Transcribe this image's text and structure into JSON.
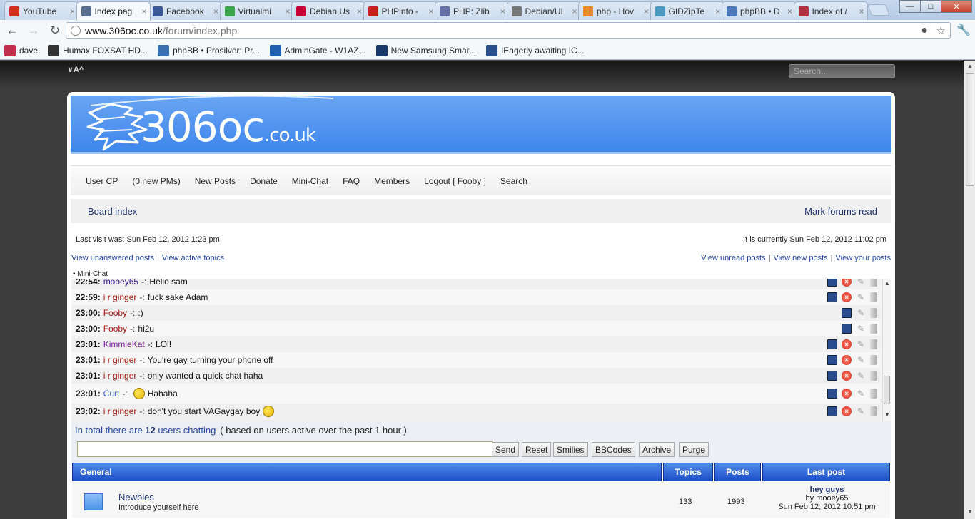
{
  "browser": {
    "tabs": [
      {
        "title": "YouTube",
        "icon": "youtube-icon",
        "color": "#d52f20"
      },
      {
        "title": "Index pag",
        "icon": "shield-icon",
        "color": "#5a6f8f",
        "active": true
      },
      {
        "title": "Facebook",
        "icon": "facebook-icon",
        "color": "#3b5998"
      },
      {
        "title": "Virtualmi",
        "icon": "check-icon",
        "color": "#3aa44a"
      },
      {
        "title": "Debian Us",
        "icon": "debian-icon",
        "color": "#c70036"
      },
      {
        "title": "PHPinfo -",
        "icon": "circle-icon",
        "color": "#c9201e"
      },
      {
        "title": "PHP: Zlib",
        "icon": "php-icon",
        "color": "#6670a8"
      },
      {
        "title": "Debian/UI",
        "icon": "gear-icon",
        "color": "#777777"
      },
      {
        "title": "php - Hov",
        "icon": "stack-icon",
        "color": "#e48a2a"
      },
      {
        "title": "GIDZipTe",
        "icon": "g-icon",
        "color": "#4a9ac0"
      },
      {
        "title": "phpBB • D",
        "icon": "people-icon",
        "color": "#4a78b8"
      },
      {
        "title": "Index of /",
        "icon": "apache-icon",
        "color": "#b03040"
      }
    ],
    "address": {
      "host": "www.306oc.co.uk",
      "path": "/forum/index.php"
    },
    "bookmarks": [
      {
        "label": "dave",
        "icon": "bookmark-icon",
        "color": "#c0304a"
      },
      {
        "label": "Humax FOXSAT HD...",
        "icon": "avforums-icon",
        "color": "#333333"
      },
      {
        "label": "phpBB • Prosilver: Pr...",
        "icon": "phpbb-icon",
        "color": "#3a6fb0"
      },
      {
        "label": "AdminGate - W1AZ...",
        "icon": "admingate-icon",
        "color": "#2060b0"
      },
      {
        "label": "New Samsung Smar...",
        "icon": "c-icon",
        "color": "#1a3a6a"
      },
      {
        "label": "IEagerly awaiting IC...",
        "icon": "android-icon",
        "color": "#2a4f8a"
      }
    ]
  },
  "site": {
    "top_links": "∨A^",
    "search_placeholder": "Search...",
    "logo": {
      "main": "306oc",
      "tld": ".co.uk"
    },
    "nav": [
      "User CP",
      "(0 new PMs)",
      "New Posts",
      "Donate",
      "Mini-Chat",
      "FAQ",
      "Members",
      "Logout [ Fooby ]",
      "Search"
    ],
    "breadcrumb": "Board index",
    "mark_read": "Mark forums read",
    "last_visit": "Last visit was: Sun Feb 12, 2012 1:23 pm",
    "current_time": "It is currently Sun Feb 12, 2012 11:02 pm",
    "quick_left": [
      "View unanswered posts",
      "View active topics"
    ],
    "quick_right": [
      "View unread posts",
      "View new posts",
      "View your posts"
    ],
    "minichat_label": "•   Mini-Chat"
  },
  "chat": {
    "messages": [
      {
        "time": "22:54:",
        "user": "mooey65",
        "color": "#3a1e8a",
        "sep": "-:",
        "text": "Hello sam",
        "pc": true,
        "del": true
      },
      {
        "time": "22:59:",
        "user": "i r ginger",
        "color": "#a0140c",
        "sep": "-:",
        "text": "fuck sake Adam",
        "pc": true,
        "del": true
      },
      {
        "time": "23:00:",
        "user": "Fooby",
        "color": "#a0140c",
        "sep": "-:",
        "text": ":)",
        "pc": true,
        "del": false
      },
      {
        "time": "23:00:",
        "user": "Fooby",
        "color": "#a0140c",
        "sep": "-:",
        "text": "hi2u",
        "pc": true,
        "del": false
      },
      {
        "time": "23:01:",
        "user": "KimmieKat",
        "color": "#7a1f9a",
        "sep": "-:",
        "text": "LOl!",
        "pc": true,
        "del": true
      },
      {
        "time": "23:01:",
        "user": "i r ginger",
        "color": "#a0140c",
        "sep": "-:",
        "text": "You're gay turning your phone off",
        "pc": true,
        "del": true
      },
      {
        "time": "23:01:",
        "user": "i r ginger",
        "color": "#a0140c",
        "sep": "-:",
        "text": "only wanted a quick chat haha",
        "pc": true,
        "del": true
      },
      {
        "time": "23:01:",
        "user": "Curt",
        "color": "#3a62c8",
        "sep": "-:",
        "text": "Hahaha",
        "pc": true,
        "del": true,
        "smiley_before": true
      },
      {
        "time": "23:02:",
        "user": "i r ginger",
        "color": "#a0140c",
        "sep": "-:",
        "text": "don't you start VAGaygay boy",
        "pc": true,
        "del": true,
        "smiley_after": true
      }
    ],
    "total_prefix": "In total there are ",
    "total_count": "12",
    "total_suffix": " users chatting",
    "total_note": "( based on users active over the past 1 hour )",
    "input_value": "",
    "buttons": [
      "Send",
      "Reset",
      "Smilies",
      "BBCodes",
      "Archive",
      "Purge"
    ]
  },
  "forum_table": {
    "category": "General",
    "col_topics": "Topics",
    "col_posts": "Posts",
    "col_last": "Last post",
    "rows": [
      {
        "name": "Newbies",
        "desc": "Introduce yourself here",
        "topics": "133",
        "posts": "1993",
        "last_title": "hey guys",
        "last_by": "by mooey65",
        "last_date": "Sun Feb 12, 2012 10:51 pm"
      }
    ]
  }
}
